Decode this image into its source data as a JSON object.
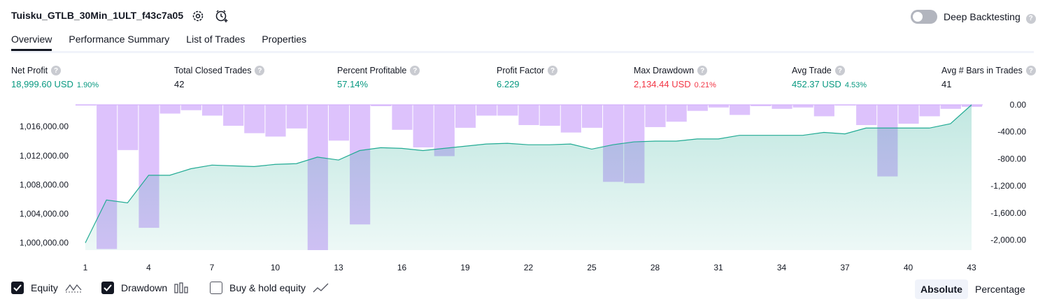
{
  "header": {
    "title": "Tuisku_GTLB_30Min_1ULT_f43c7a05",
    "deep_backtesting_label": "Deep Backtesting",
    "help_glyph": "?"
  },
  "tabs": [
    "Overview",
    "Performance Summary",
    "List of Trades",
    "Properties"
  ],
  "stats": {
    "net_profit": {
      "label": "Net Profit",
      "value": "18,999.60 USD",
      "pct": "1.90%"
    },
    "total_closed_trades": {
      "label": "Total Closed Trades",
      "value": "42"
    },
    "percent_profitable": {
      "label": "Percent Profitable",
      "value": "57.14%"
    },
    "profit_factor": {
      "label": "Profit Factor",
      "value": "6.229"
    },
    "max_drawdown": {
      "label": "Max Drawdown",
      "value": "2,134.44 USD",
      "pct": "0.21%"
    },
    "avg_trade": {
      "label": "Avg Trade",
      "value": "452.37 USD",
      "pct": "4.53%"
    },
    "avg_bars": {
      "label": "Avg # Bars in Trades",
      "value": "41"
    }
  },
  "legend": {
    "equity": "Equity",
    "drawdown": "Drawdown",
    "buy_hold": "Buy & hold equity",
    "equity_checked": true,
    "drawdown_checked": true,
    "buy_hold_checked": false
  },
  "mode_buttons": {
    "absolute": "Absolute",
    "percentage": "Percentage"
  },
  "colors": {
    "green": "#089981",
    "red": "#f23645",
    "equity_line": "#22ab94",
    "drawdown_fill": "#cfa8fb"
  },
  "chart_data": {
    "type": "area",
    "x_ticks": [
      "1",
      "4",
      "7",
      "10",
      "13",
      "16",
      "19",
      "22",
      "25",
      "28",
      "31",
      "34",
      "37",
      "40",
      "43"
    ],
    "left_axis": {
      "ylim": [
        999000,
        1019000
      ],
      "ticks": [
        "1,000,000.00",
        "1,004,000.00",
        "1,008,000.00",
        "1,012,000.00",
        "1,016,000.00"
      ]
    },
    "right_axis": {
      "ylim": [
        -2150,
        0
      ],
      "ticks": [
        "0.00",
        "-400.00",
        "-800.00",
        "-1,200.00",
        "-1,600.00",
        "-2,000.00"
      ]
    },
    "series": [
      {
        "name": "Equity",
        "x": [
          1,
          2,
          3,
          4,
          5,
          6,
          7,
          8,
          9,
          10,
          11,
          12,
          13,
          14,
          15,
          16,
          17,
          18,
          19,
          20,
          21,
          22,
          23,
          24,
          25,
          26,
          27,
          28,
          29,
          30,
          31,
          32,
          33,
          34,
          35,
          36,
          37,
          38,
          39,
          40,
          41,
          42,
          43
        ],
        "values": [
          1000000,
          1005900,
          1005500,
          1009300,
          1009300,
          1010200,
          1010700,
          1010600,
          1010500,
          1010800,
          1010900,
          1011800,
          1011400,
          1012700,
          1013100,
          1013000,
          1012700,
          1013000,
          1013300,
          1013600,
          1013700,
          1013500,
          1013500,
          1013600,
          1012900,
          1013500,
          1013900,
          1014000,
          1014000,
          1014300,
          1014300,
          1014800,
          1014800,
          1014800,
          1014800,
          1015200,
          1015000,
          1015800,
          1015800,
          1015800,
          1015800,
          1016400,
          1019000
        ]
      },
      {
        "name": "Drawdown",
        "x": [
          1,
          2,
          3,
          4,
          5,
          6,
          7,
          8,
          9,
          10,
          11,
          12,
          13,
          14,
          15,
          16,
          17,
          18,
          19,
          20,
          21,
          22,
          23,
          24,
          25,
          26,
          27,
          28,
          29,
          30,
          31,
          32,
          33,
          34,
          35,
          36,
          37,
          38,
          39,
          40,
          41,
          42,
          43
        ],
        "values": [
          -10,
          -2134,
          -670,
          -1820,
          -130,
          -80,
          -160,
          -310,
          -420,
          -470,
          -350,
          -2150,
          -530,
          -1770,
          -20,
          -370,
          -630,
          -760,
          -340,
          -160,
          -160,
          -300,
          -310,
          -410,
          -340,
          -1140,
          -1160,
          -330,
          -250,
          -90,
          -40,
          -150,
          -20,
          -60,
          -40,
          -170,
          -10,
          -300,
          -1060,
          -280,
          -170,
          -60,
          -30
        ]
      }
    ]
  }
}
